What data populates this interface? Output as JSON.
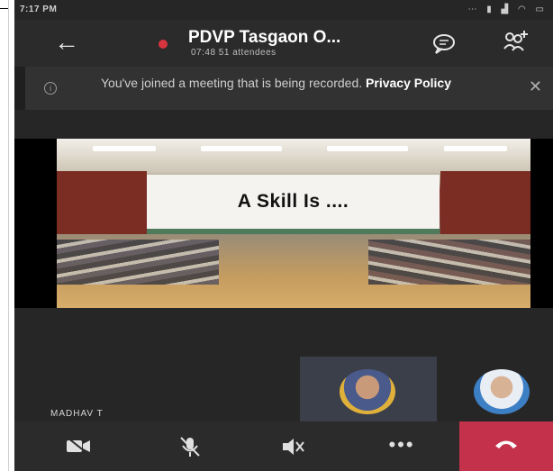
{
  "status_bar": {
    "time": "7:17 PM",
    "icons": [
      "notification-icon",
      "battery-icon",
      "signal-icon",
      "wifi-icon",
      "battery-full-icon"
    ]
  },
  "header": {
    "meeting_title": "PDVP Tasgaon O...",
    "meeting_subtitle": "07:48  51 attendees",
    "recording_color": "#d6343e"
  },
  "banner": {
    "message": "You've joined a meeting that is being recorded.",
    "link_label": "Privacy Policy",
    "close_label": "✕"
  },
  "shared_screen": {
    "slide_text": "A Skill Is ...."
  },
  "participants": {
    "presenter_name": "MADHAV T"
  },
  "controls": {
    "more_label": "•••",
    "hangup_color": "#c4314b"
  }
}
